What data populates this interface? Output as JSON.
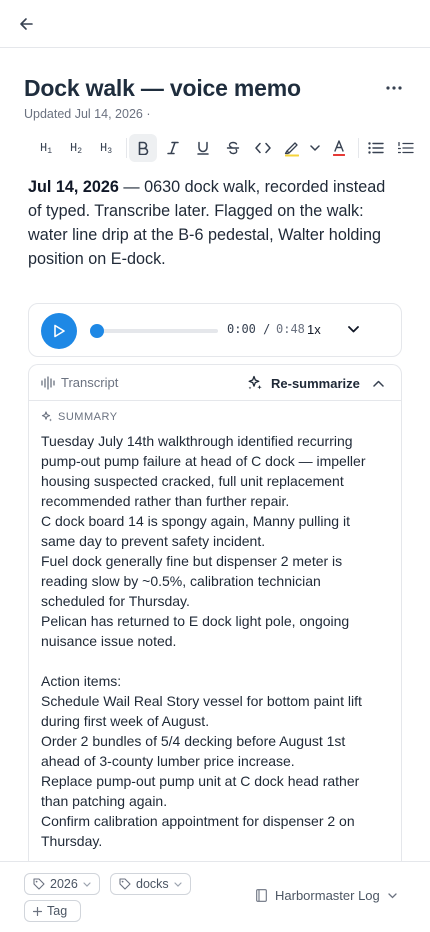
{
  "note": {
    "title": "Dock walk — voice memo",
    "updated": "Updated Jul 14, 2026  ·",
    "body_date": "Jul 14, 2026",
    "body_text": " — 0630 dock walk, recorded instead of typed. Transcribe later. Flagged on the walk: water line drip at the B-6 pedestal, Walter holding position on E-dock."
  },
  "toolbar": {
    "h1": "H",
    "h2": "H",
    "h3": "H",
    "h1_num": "1",
    "h2_num": "2",
    "h3_num": "3",
    "highlight_color": "#f5d33b",
    "text_color_underline": "#e53935"
  },
  "player": {
    "current_time": "0:00 /",
    "duration": "0:48",
    "speed": "1x",
    "progress": 0,
    "accent": "#1e88e5"
  },
  "transcript": {
    "label": "Transcript",
    "resummarize": "Re-summarize",
    "summary_label": "SUMMARY",
    "summary_lines": [
      "Tuesday July 14th walkthrough identified recurring pump-out pump failure at head of C dock — impeller housing suspected cracked, full unit replacement recommended rather than further repair.",
      "C dock board 14 is spongy again, Manny pulling it same day to prevent safety incident.",
      "Fuel dock generally fine but dispenser 2 meter is reading slow by ~0.5%, calibration technician scheduled for Thursday.",
      "Pelican has returned to E dock light pole, ongoing nuisance issue noted."
    ],
    "action_label": "Action items:",
    "action_items": [
      "Schedule Wail Real Story vessel for bottom paint lift during first week of August.",
      "Order 2 bundles of 5/4 decking before August 1st ahead of 3-county lumber price increase.",
      "Replace pump-out pump unit at C dock head rather than patching again.",
      "Confirm calibration appointment for dispenser 2 on Thursday."
    ]
  },
  "footer": {
    "tags": [
      "2026",
      "docks"
    ],
    "add_tag": "Tag",
    "notebook": "Harbormaster Log"
  }
}
